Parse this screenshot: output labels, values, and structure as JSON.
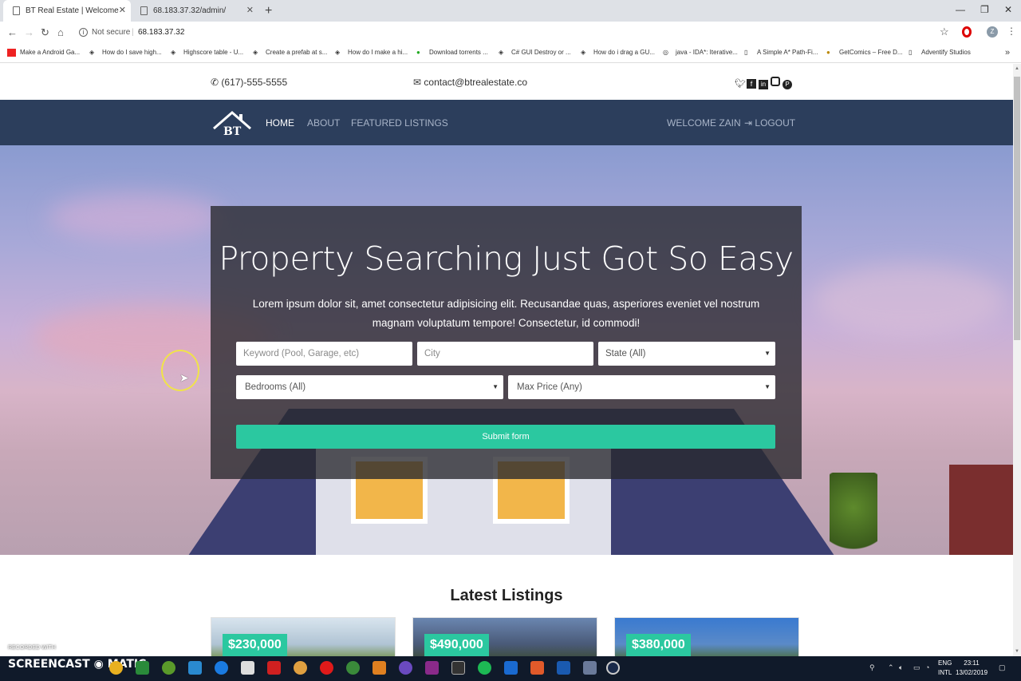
{
  "browser": {
    "tabs": [
      {
        "title": "BT Real Estate | Welcome",
        "active": true
      },
      {
        "title": "68.183.37.32/admin/",
        "active": false
      }
    ],
    "security": "Not secure",
    "url": "68.183.37.32",
    "profile_initial": "Z",
    "bookmarks": [
      "Make a Android Ga...",
      "How do I save high...",
      "Highscore table - U...",
      "Create a prefab at s...",
      "How do I make a hi...",
      "Download torrents ...",
      "C# GUI Destroy or ...",
      "How do i drag a GU...",
      "java - IDA*: Iterative...",
      "A Simple A* Path-Fi...",
      "GetComics – Free D...",
      "Adventify Studios"
    ]
  },
  "site": {
    "phone": "(617)-555-5555",
    "email": "contact@btrealestate.co",
    "social_icons": [
      "twitter-icon",
      "facebook-icon",
      "linkedin-icon",
      "instagram-icon",
      "pinterest-icon"
    ],
    "logo_text": "BT",
    "nav": {
      "home": "HOME",
      "about": "ABOUT",
      "featured": "FEATURED LISTINGS",
      "welcome": "WELCOME ZAIN",
      "logout": "LOGOUT"
    },
    "search": {
      "title": "Property Searching Just Got So Easy",
      "description": "Lorem ipsum dolor sit, amet consectetur adipisicing elit. Recusandae quas, asperiores eveniet vel nostrum magnam voluptatum tempore! Consectetur, id commodi!",
      "keyword_placeholder": "Keyword (Pool, Garage, etc)",
      "city_placeholder": "City",
      "state_selected": "State (All)",
      "bedrooms_selected": "Bedrooms (All)",
      "price_selected": "Max Price (Any)",
      "submit_label": "Submit form"
    },
    "latest_heading": "Latest Listings",
    "listings": [
      {
        "price": "$230,000"
      },
      {
        "price": "$490,000"
      },
      {
        "price": "$380,000"
      }
    ]
  },
  "overlay": {
    "recorded_with": "RECORDED WITH",
    "screencast": "SCREENCAST",
    "matic": "MATIC"
  },
  "taskbar": {
    "lang_1": "ENG",
    "lang_2": "INTL",
    "time": "23:11",
    "date": "13/02/2019"
  },
  "colors": {
    "navbar": "#2c3e5c",
    "accent": "#2bc8a0"
  }
}
